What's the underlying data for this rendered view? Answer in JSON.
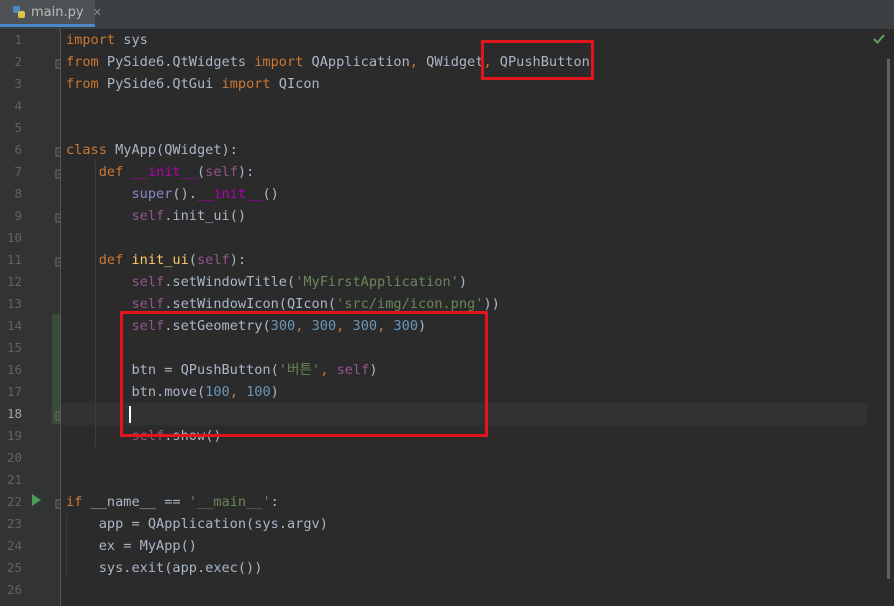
{
  "tab": {
    "filename": "main.py",
    "close": "✕"
  },
  "lines": [
    {
      "n": "1",
      "html": "<span class=\"kw\">import</span> sys"
    },
    {
      "n": "2",
      "html": "<span class=\"kw\">from</span> PySide6.QtWidgets <span class=\"kw\">import</span> QApplication<span class=\"kw\">,</span> QWidget<span class=\"kw\">,</span> QPushButton"
    },
    {
      "n": "3",
      "html": "<span class=\"kw\">from</span> PySide6.QtGui <span class=\"kw\">import</span> QIcon"
    },
    {
      "n": "4",
      "html": ""
    },
    {
      "n": "5",
      "html": ""
    },
    {
      "n": "6",
      "html": "<span class=\"kw\">class</span> MyApp(QWidget):"
    },
    {
      "n": "7",
      "html": "    <span class=\"kw\">def</span> <span class=\"magic\">__init__</span>(<span class=\"selfp\">self</span>):"
    },
    {
      "n": "8",
      "html": "        <span class=\"builtin\">super</span>().<span class=\"magic\">__init__</span>()"
    },
    {
      "n": "9",
      "html": "        <span class=\"selfp\">self</span>.init_ui()"
    },
    {
      "n": "10",
      "html": ""
    },
    {
      "n": "11",
      "html": "    <span class=\"kw\">def</span> <span class=\"fn\">init_ui</span>(<span class=\"selfp\">self</span>):"
    },
    {
      "n": "12",
      "html": "        <span class=\"selfp\">self</span>.setWindowTitle(<span class=\"str\">'MyFirstApplication'</span>)"
    },
    {
      "n": "13",
      "html": "        <span class=\"selfp\">self</span>.setWindowIcon(QIcon(<span class=\"str\">'src/img/icon.png'</span>))"
    },
    {
      "n": "14",
      "html": "        <span class=\"selfp\">self</span>.setGeometry(<span class=\"num\">300</span><span class=\"kw\">,</span> <span class=\"num\">300</span><span class=\"kw\">,</span> <span class=\"num\">300</span><span class=\"kw\">,</span> <span class=\"num\">300</span>)"
    },
    {
      "n": "15",
      "html": ""
    },
    {
      "n": "16",
      "html": "        btn = QPushButton(<span class=\"str\">'버튼'</span><span class=\"kw\">,</span> <span class=\"selfp\">self</span>)"
    },
    {
      "n": "17",
      "html": "        btn.move(<span class=\"num\">100</span><span class=\"kw\">,</span> <span class=\"num\">100</span>)"
    },
    {
      "n": "18",
      "html": ""
    },
    {
      "n": "19",
      "html": "        <span class=\"selfp\">self</span>.show()"
    },
    {
      "n": "20",
      "html": ""
    },
    {
      "n": "21",
      "html": ""
    },
    {
      "n": "22",
      "html": "<span class=\"kw\">if</span> __name__ == <span class=\"str\">'__main__'</span>:"
    },
    {
      "n": "23",
      "html": "    app = QApplication(sys.argv)"
    },
    {
      "n": "24",
      "html": "    ex = MyApp()"
    },
    {
      "n": "25",
      "html": "    sys.exit(app.exec())"
    },
    {
      "n": "26",
      "html": ""
    }
  ],
  "current_line": "18",
  "colors": {
    "keyword": "#cc7832",
    "string": "#6a8759",
    "number": "#6897bb",
    "function": "#ffc66d",
    "self": "#94558d",
    "highlight_box": "#e3151c"
  },
  "icons": {
    "file": "python-file-icon",
    "run": "run-icon",
    "bulb": "intention-bulb-icon",
    "status": "inspection-ok-icon"
  }
}
